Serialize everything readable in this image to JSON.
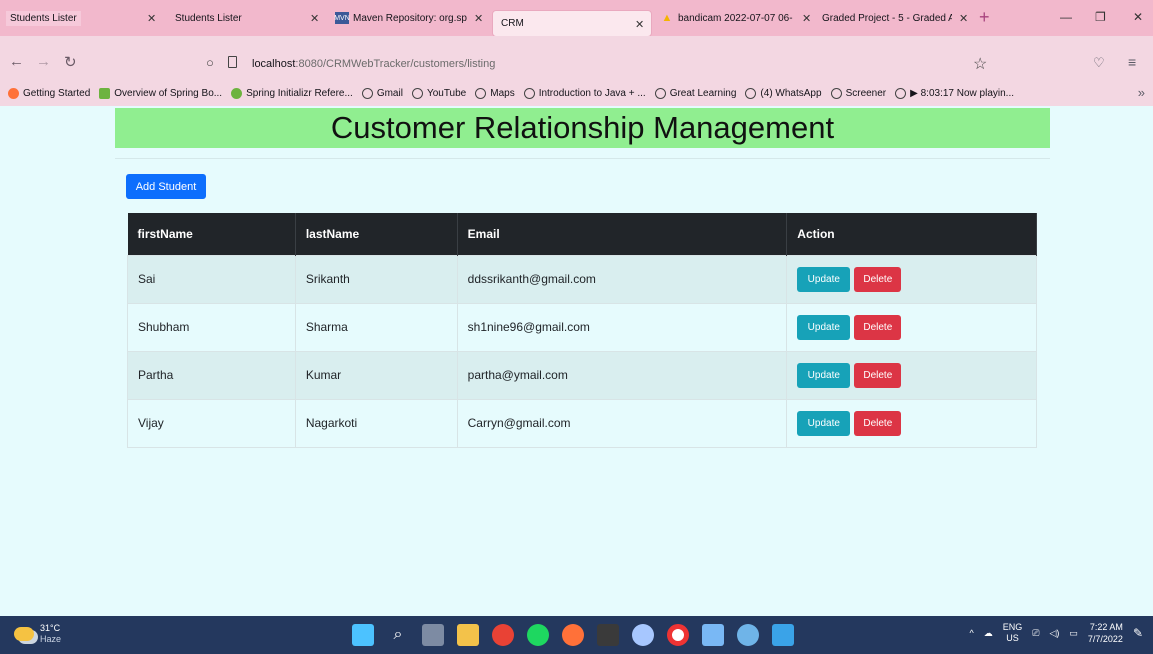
{
  "browser": {
    "tabs": [
      {
        "label": "Students Lister",
        "active": false
      },
      {
        "label": "Students Lister",
        "active": false
      },
      {
        "label": "Maven Repository: org.sp",
        "active": false
      },
      {
        "label": "CRM",
        "active": true
      },
      {
        "label": "bandicam 2022-07-07 06-",
        "active": false
      },
      {
        "label": "Graded Project - 5 - Graded A",
        "active": false
      }
    ],
    "url_host": "localhost",
    "url_rest": ":8080/CRMWebTracker/customers/listing",
    "bookmarks": [
      "Getting Started",
      "Overview of Spring Bo...",
      "Spring Initializr Refere...",
      "Gmail",
      "YouTube",
      "Maps",
      "Introduction to Java + ...",
      "Great Learning",
      "(4) WhatsApp",
      "Screener",
      "▶ 8:03:17 Now playin..."
    ]
  },
  "page": {
    "title": "Customer Relationship Management",
    "add_button": "Add Student",
    "table": {
      "headers": [
        "firstName",
        "lastName",
        "Email",
        "Action"
      ],
      "rows": [
        {
          "firstName": "Sai",
          "lastName": "Srikanth",
          "email": "ddssrikanth@gmail.com"
        },
        {
          "firstName": "Shubham",
          "lastName": "Sharma",
          "email": "sh1nine96@gmail.com"
        },
        {
          "firstName": "Partha",
          "lastName": "Kumar",
          "email": "partha@ymail.com"
        },
        {
          "firstName": "Vijay",
          "lastName": "Nagarkoti",
          "email": "Carryn@gmail.com"
        }
      ],
      "update_label": "Update",
      "delete_label": "Delete"
    }
  },
  "taskbar": {
    "weather_temp": "31°C",
    "weather_desc": "Haze",
    "lang": "ENG",
    "region": "US",
    "time": "7:22 AM",
    "date": "7/7/2022"
  },
  "colors": {
    "header_green": "#90ee90",
    "primary": "#0d6efd",
    "info": "#17a2b8",
    "danger": "#dc3545",
    "table_dark": "#212529"
  }
}
